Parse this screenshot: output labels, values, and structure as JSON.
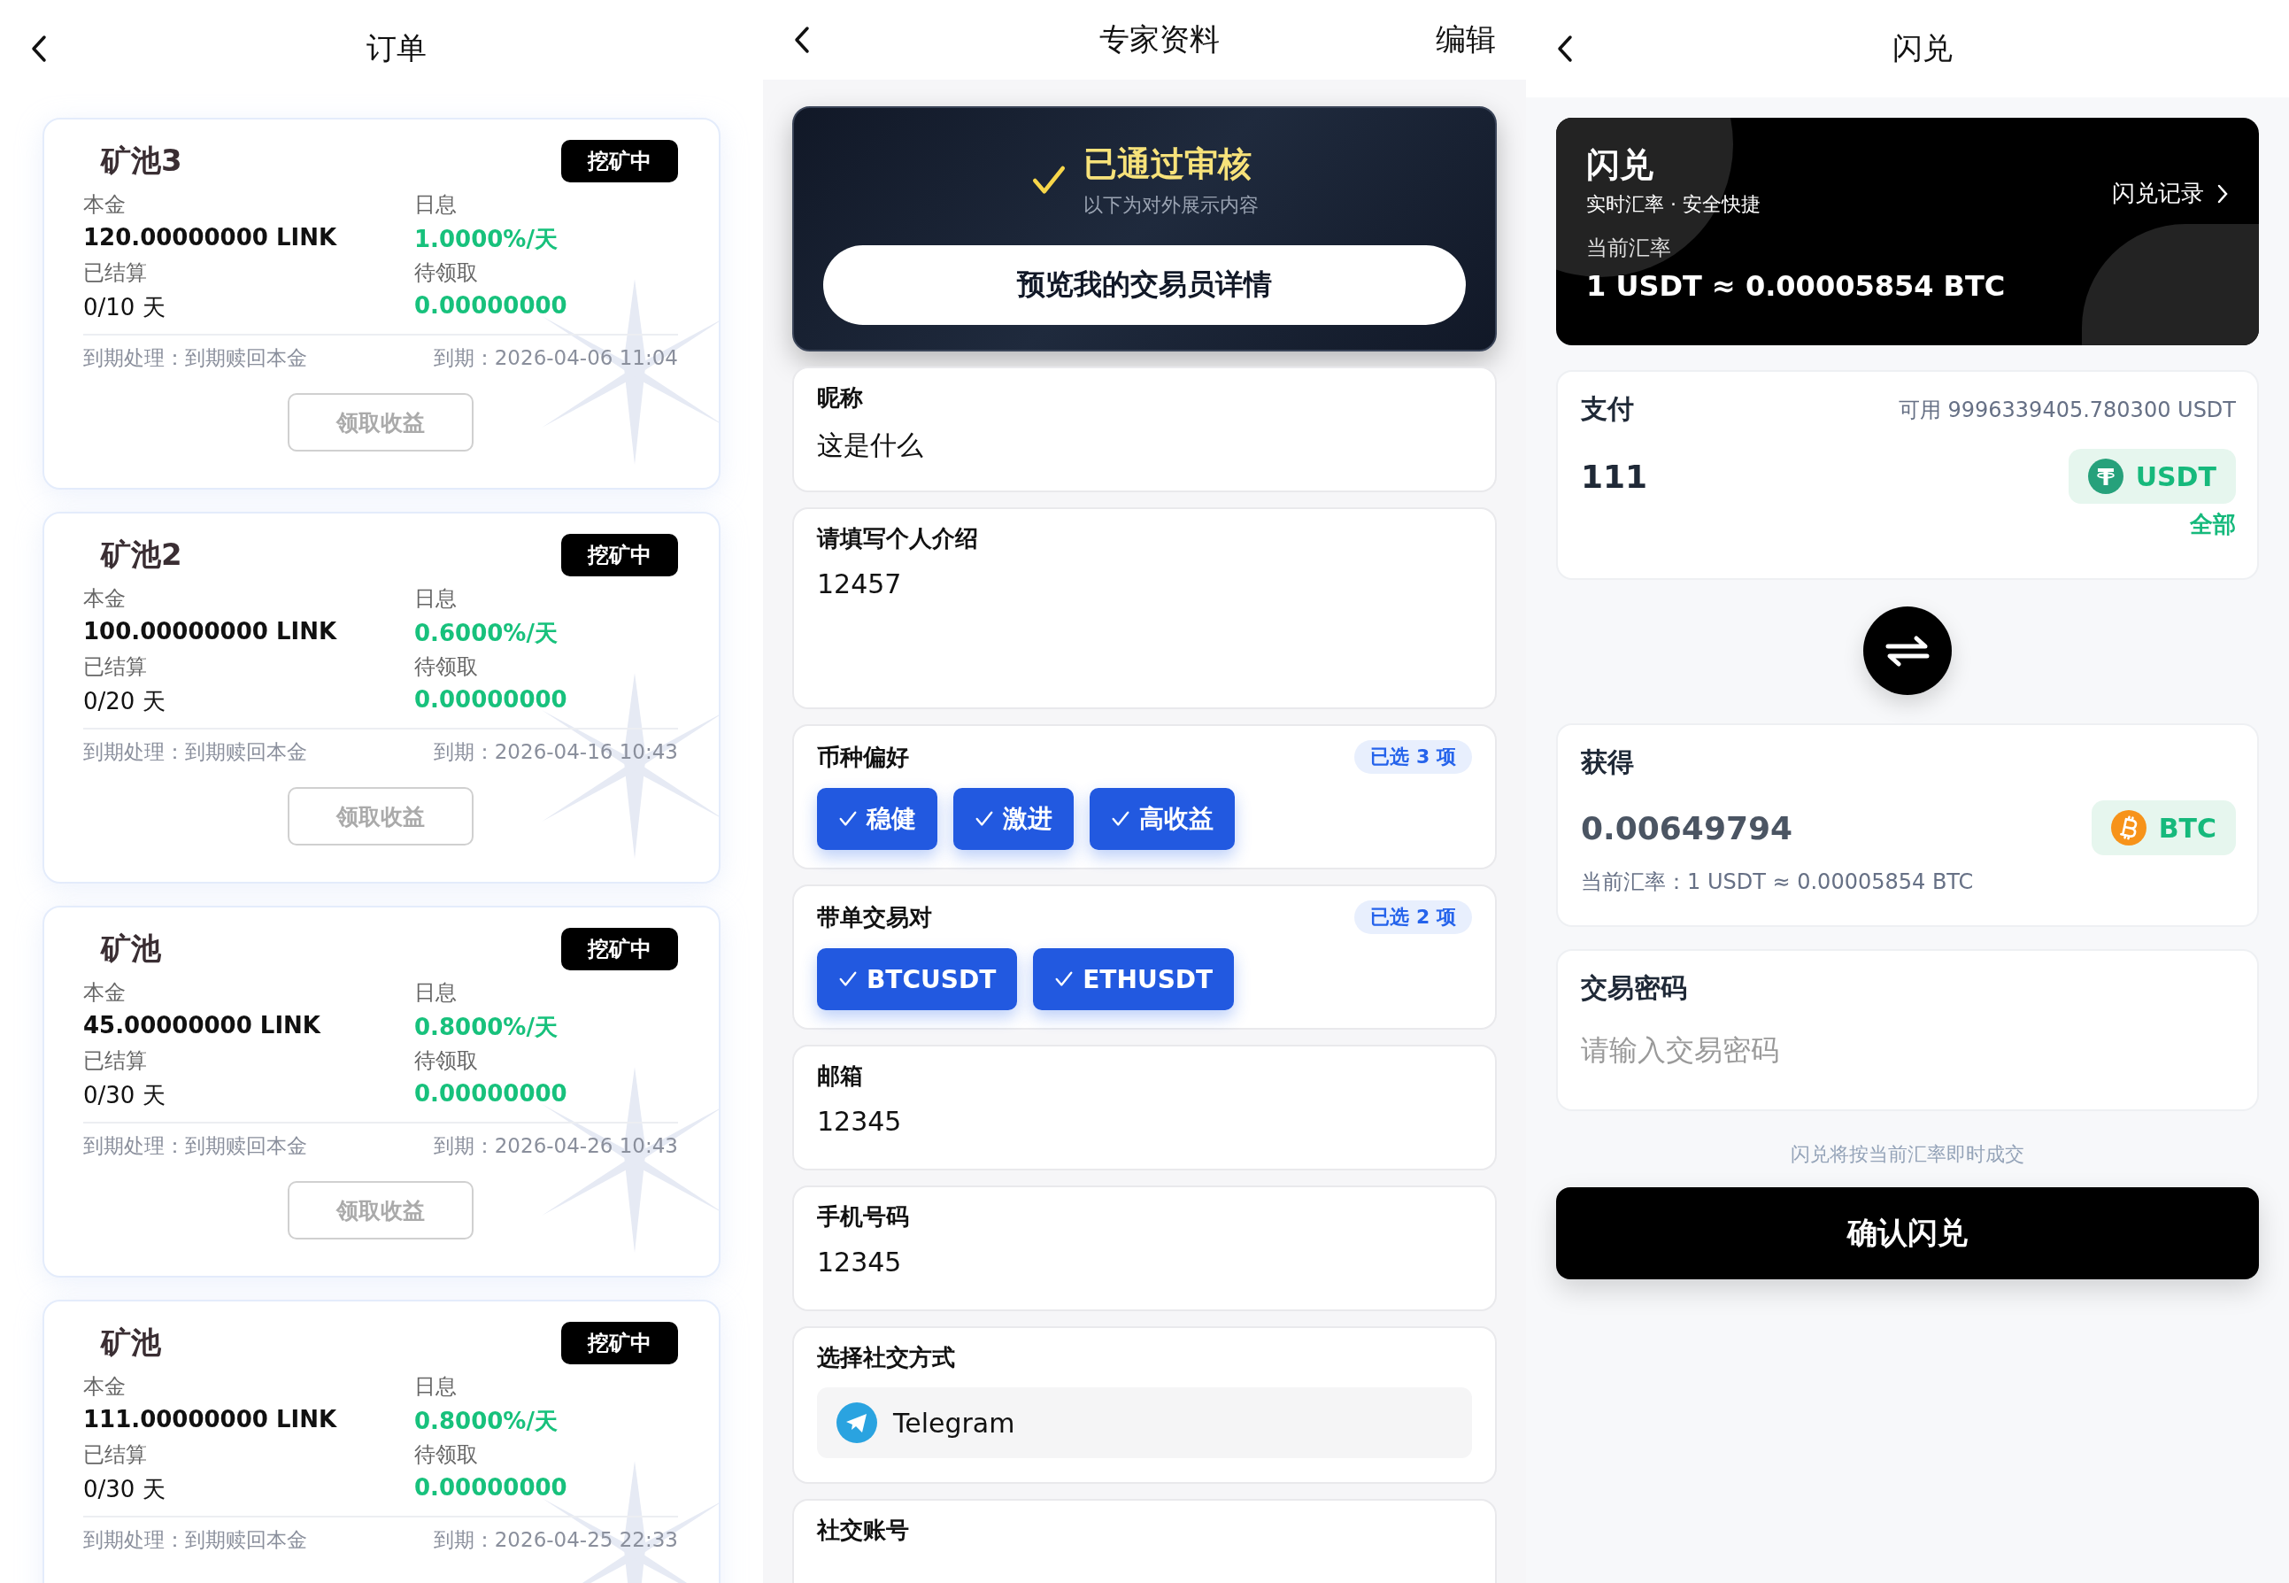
{
  "orders": {
    "title": "订单",
    "items": [
      {
        "name": "矿池3",
        "status": "挖矿中",
        "principal_label": "本金",
        "principal": "120.00000000 LINK",
        "rate_label": "日息",
        "rate": "1.0000%/天",
        "settled_label": "已结算",
        "settled": "0/10 天",
        "pending_label": "待领取",
        "pending": "0.00000000",
        "expiry_action": "到期处理：到期赎回本金",
        "expiry": "到期：2026-04-06 11:04",
        "button": {
          "label": "领取收益",
          "disabled": true
        }
      },
      {
        "name": "矿池2",
        "status": "挖矿中",
        "principal_label": "本金",
        "principal": "100.00000000 LINK",
        "rate_label": "日息",
        "rate": "0.6000%/天",
        "settled_label": "已结算",
        "settled": "0/20 天",
        "pending_label": "待领取",
        "pending": "0.00000000",
        "expiry_action": "到期处理：到期赎回本金",
        "expiry": "到期：2026-04-16 10:43",
        "button": {
          "label": "领取收益",
          "disabled": true
        }
      },
      {
        "name": "矿池",
        "status": "挖矿中",
        "principal_label": "本金",
        "principal": "45.00000000 LINK",
        "rate_label": "日息",
        "rate": "0.8000%/天",
        "settled_label": "已结算",
        "settled": "0/30 天",
        "pending_label": "待领取",
        "pending": "0.00000000",
        "expiry_action": "到期处理：到期赎回本金",
        "expiry": "到期：2026-04-26 10:43",
        "button": {
          "label": "领取收益",
          "disabled": true
        }
      },
      {
        "name": "矿池",
        "status": "挖矿中",
        "principal_label": "本金",
        "principal": "111.00000000 LINK",
        "rate_label": "日息",
        "rate": "0.8000%/天",
        "settled_label": "已结算",
        "settled": "0/30 天",
        "pending_label": "待领取",
        "pending": "0.00000000",
        "expiry_action": "到期处理：到期赎回本金",
        "expiry": "到期：2026-04-25 22:33"
      }
    ]
  },
  "profile": {
    "title": "专家资料",
    "action": "编辑",
    "review": {
      "title": "已通过审核",
      "subtitle": "以下为对外展示内容",
      "button": "预览我的交易员详情"
    },
    "fields": [
      {
        "kind": "text",
        "label": "昵称",
        "value": "这是什么"
      },
      {
        "kind": "textarea",
        "label": "请填写个人介绍",
        "value": "12457"
      },
      {
        "kind": "tags",
        "label": "币种偏好",
        "count": "已选 3 项",
        "tags": [
          {
            "label": "稳健",
            "selected": true
          },
          {
            "label": "激进",
            "selected": true
          },
          {
            "label": "高收益",
            "selected": true
          }
        ]
      },
      {
        "kind": "tags",
        "label": "带单交易对",
        "count": "已选 2 项",
        "tags": [
          {
            "label": "BTCUSDT",
            "selected": true
          },
          {
            "label": "ETHUSDT",
            "selected": true
          }
        ]
      },
      {
        "kind": "text",
        "label": "邮箱",
        "value": "12345"
      },
      {
        "kind": "text",
        "label": "手机号码",
        "value": "12345"
      },
      {
        "kind": "select",
        "label": "选择社交方式",
        "value": "Telegram"
      },
      {
        "kind": "text",
        "label": "社交账号"
      }
    ]
  },
  "swap": {
    "title": "闪兑",
    "hero": {
      "title": "闪兑",
      "subtitle": "实时汇率 · 安全快捷",
      "link": "闪兑记录",
      "rate_label": "当前汇率",
      "rate": "1 USDT ≈ 0.00005854 BTC"
    },
    "pay": {
      "label": "支付",
      "available": "可用 9996339405.780300 USDT",
      "amount": "111",
      "coin": {
        "kind": "tether",
        "symbol": "USDT"
      },
      "all": "全部"
    },
    "receive": {
      "label": "获得",
      "amount": "0.00649794",
      "coin": {
        "kind": "bitcoin",
        "symbol": "BTC"
      },
      "rate": "当前汇率：1 USDT ≈ 0.00005854 BTC"
    },
    "password": {
      "label": "交易密码",
      "placeholder": "请输入交易密码"
    },
    "note": "闪兑将按当前汇率即时成交",
    "button": "确认闪兑"
  }
}
